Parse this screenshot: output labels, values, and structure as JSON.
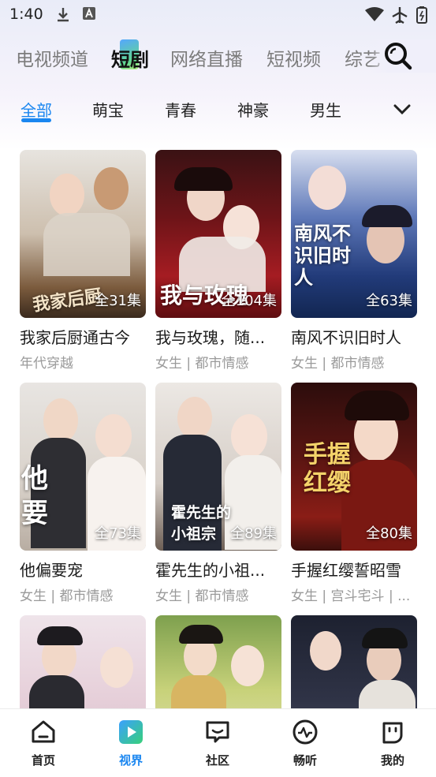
{
  "status_bar": {
    "time": "1:40"
  },
  "top_tabs": [
    {
      "label": "电视频道"
    },
    {
      "label": "短剧"
    },
    {
      "label": "网络直播"
    },
    {
      "label": "短视频"
    },
    {
      "label": "综艺"
    }
  ],
  "sub_tabs": [
    {
      "label": "全部"
    },
    {
      "label": "萌宝"
    },
    {
      "label": "青春"
    },
    {
      "label": "神豪"
    },
    {
      "label": "男生"
    }
  ],
  "dramas": [
    {
      "title": "我家后厨通古今",
      "tags": "年代穿越",
      "episodes": "全31集",
      "poster_text": "我家后厨"
    },
    {
      "title": "我与玫瑰，随...",
      "tags": "女生 | 都市情感",
      "episodes": "全104集",
      "poster_text": "我与玫瑰"
    },
    {
      "title": "南风不识旧时人",
      "tags": "女生 | 都市情感",
      "episodes": "全63集",
      "poster_text": "南风不识旧时人"
    },
    {
      "title": "他偏要宠",
      "tags": "女生 | 都市情感",
      "episodes": "全73集",
      "poster_text": "他要"
    },
    {
      "title": "霍先生的小祖...",
      "tags": "女生 | 都市情感",
      "episodes": "全89集",
      "poster_text": "霍先生的小祖宗"
    },
    {
      "title": "手握红缨誓昭雪",
      "tags": "女生 | 宫斗宅斗 | ...",
      "episodes": "全80集",
      "poster_text": "手握红缨"
    },
    {
      "title": "",
      "tags": "",
      "episodes": "",
      "poster_text": ""
    },
    {
      "title": "",
      "tags": "",
      "episodes": "",
      "poster_text": ""
    },
    {
      "title": "",
      "tags": "",
      "episodes": "",
      "poster_text": ""
    }
  ],
  "bottom_nav": [
    {
      "label": "首页",
      "icon": "home-icon"
    },
    {
      "label": "视界",
      "icon": "play-icon"
    },
    {
      "label": "社区",
      "icon": "chat-icon"
    },
    {
      "label": "畅听",
      "icon": "audio-wave-icon"
    },
    {
      "label": "我的",
      "icon": "profile-icon"
    }
  ],
  "colors": {
    "accent": "#1a86f0"
  }
}
